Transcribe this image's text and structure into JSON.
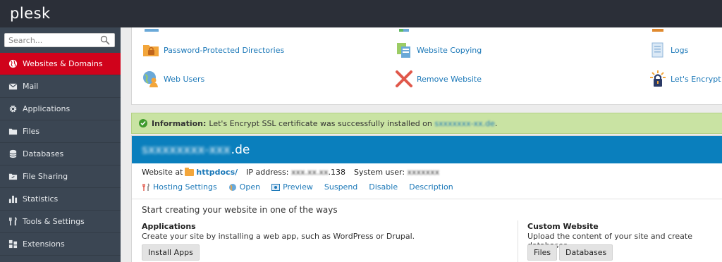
{
  "app": {
    "logo": "plesk"
  },
  "search": {
    "placeholder": "Search..."
  },
  "sidebar": {
    "items": [
      {
        "label": "Websites & Domains",
        "icon": "globe-icon",
        "active": true
      },
      {
        "label": "Mail",
        "icon": "envelope-icon"
      },
      {
        "label": "Applications",
        "icon": "gear-icon"
      },
      {
        "label": "Files",
        "icon": "folder-icon"
      },
      {
        "label": "Databases",
        "icon": "database-icon"
      },
      {
        "label": "File Sharing",
        "icon": "share-icon"
      },
      {
        "label": "Statistics",
        "icon": "bar-chart-icon"
      },
      {
        "label": "Tools & Settings",
        "icon": "tools-icon"
      },
      {
        "label": "Extensions",
        "icon": "extensions-icon"
      }
    ]
  },
  "tools": {
    "password_protected": "Password-Protected Directories",
    "website_copying": "Website Copying",
    "logs": "Logs",
    "web_users": "Web Users",
    "remove_website": "Remove Website",
    "lets_encrypt": "Let's Encrypt"
  },
  "notice": {
    "label": "Information:",
    "text": "Let's Encrypt SSL certificate was successfully installed on",
    "domain_blurred": "sxxxxxxx-xx.de",
    "end": "."
  },
  "domain": {
    "blurred_part": "sxxxxxxxx-xxx",
    "suffix": ".de",
    "website_at": "Website at",
    "docroot": "httpdocs/",
    "ip_label": "IP address:",
    "ip_blurred": "xxx.xx.xx",
    "ip_suffix": ".138",
    "system_user_label": "System user:",
    "system_user_blurred": "xxxxxxx"
  },
  "actions": {
    "hosting_settings": "Hosting Settings",
    "open": "Open",
    "preview": "Preview",
    "suspend": "Suspend",
    "disable": "Disable",
    "description": "Description"
  },
  "start": {
    "heading": "Start creating your website in one of the ways",
    "applications_title": "Applications",
    "applications_text": "Create your site by installing a web app, such as WordPress or Drupal.",
    "install_apps": "Install Apps",
    "custom_title": "Custom Website",
    "custom_text": "Upload the content of your site and create databases.",
    "files_button": "Files",
    "databases_button": "Databases"
  },
  "colors": {
    "topbar": "#2b2f38",
    "sidebar": "#3b4653",
    "active": "#d0021b",
    "link": "#1b78b8",
    "domain_bar": "#0a7fbd",
    "notice": "#c9e3a3"
  }
}
